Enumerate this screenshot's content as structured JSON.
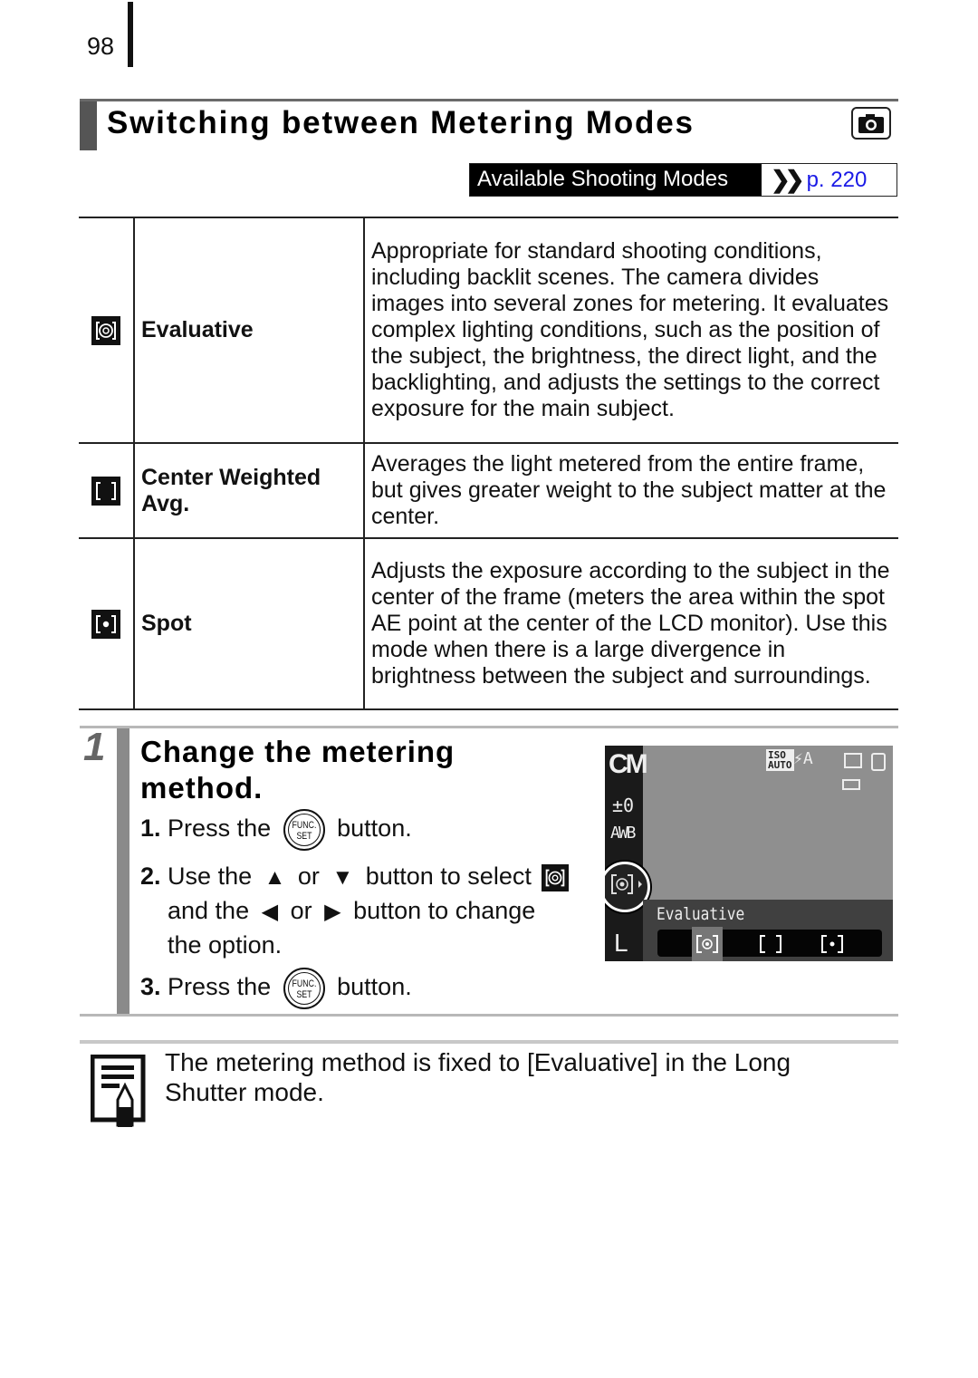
{
  "page": {
    "number": "98",
    "title": "Switching between Metering Modes",
    "title_icon": "camera-shooting-mode-icon",
    "available_modes": {
      "label": "Available Shooting Modes",
      "link_icon": "double-chevron-right-icon",
      "link_text": "p. 220",
      "link_color": "#1a1ae6"
    }
  },
  "modes_table": {
    "rows": [
      {
        "icon": "evaluative-metering-icon",
        "name": "Evaluative",
        "description": "Appropriate for standard shooting conditions, including backlit scenes. The camera divides images into several zones for metering. It evaluates complex lighting conditions, such as the position of the subject, the brightness, the direct light, and the backlighting, and adjusts the settings to the correct exposure for the main subject."
      },
      {
        "icon": "center-weighted-metering-icon",
        "name": "Center Weighted Avg.",
        "description": "Averages the light metered from the entire frame, but gives greater weight to the subject matter at the center."
      },
      {
        "icon": "spot-metering-icon",
        "name": "Spot",
        "description": "Adjusts the exposure according to the subject in the center of the frame (meters the area within the spot AE point at the center of the LCD monitor). Use this mode when there is a large divergence in brightness between the subject and surroundings."
      }
    ]
  },
  "step": {
    "number": "1",
    "title": "Change the metering method.",
    "instructions": [
      {
        "num": "1.",
        "before": "Press the",
        "button": "FUNC. SET",
        "after": "button."
      },
      {
        "num": "2.",
        "before": "Use the",
        "or1": "or",
        "mid1": "button to select",
        "line2_before": "and the",
        "or2": "or",
        "line2_after": "button to change",
        "line3": "the option."
      },
      {
        "num": "3.",
        "before": "Press the",
        "button": "FUNC. SET",
        "after": "button."
      }
    ],
    "func_top": "FUNC.",
    "func_bottom": "SET"
  },
  "lcd": {
    "mode": "CM",
    "exposure": "±0",
    "white_balance": "AWB",
    "iso": "ISO AUTO",
    "flash": "⚡A",
    "selected_label": "Evaluative",
    "size": "L",
    "options": [
      "evaluative",
      "center-weighted",
      "spot"
    ],
    "selected_index": 0
  },
  "note": {
    "icon": "memo-pencil-icon",
    "text": "The metering method is fixed to [Evaluative] in the Long Shutter mode."
  }
}
